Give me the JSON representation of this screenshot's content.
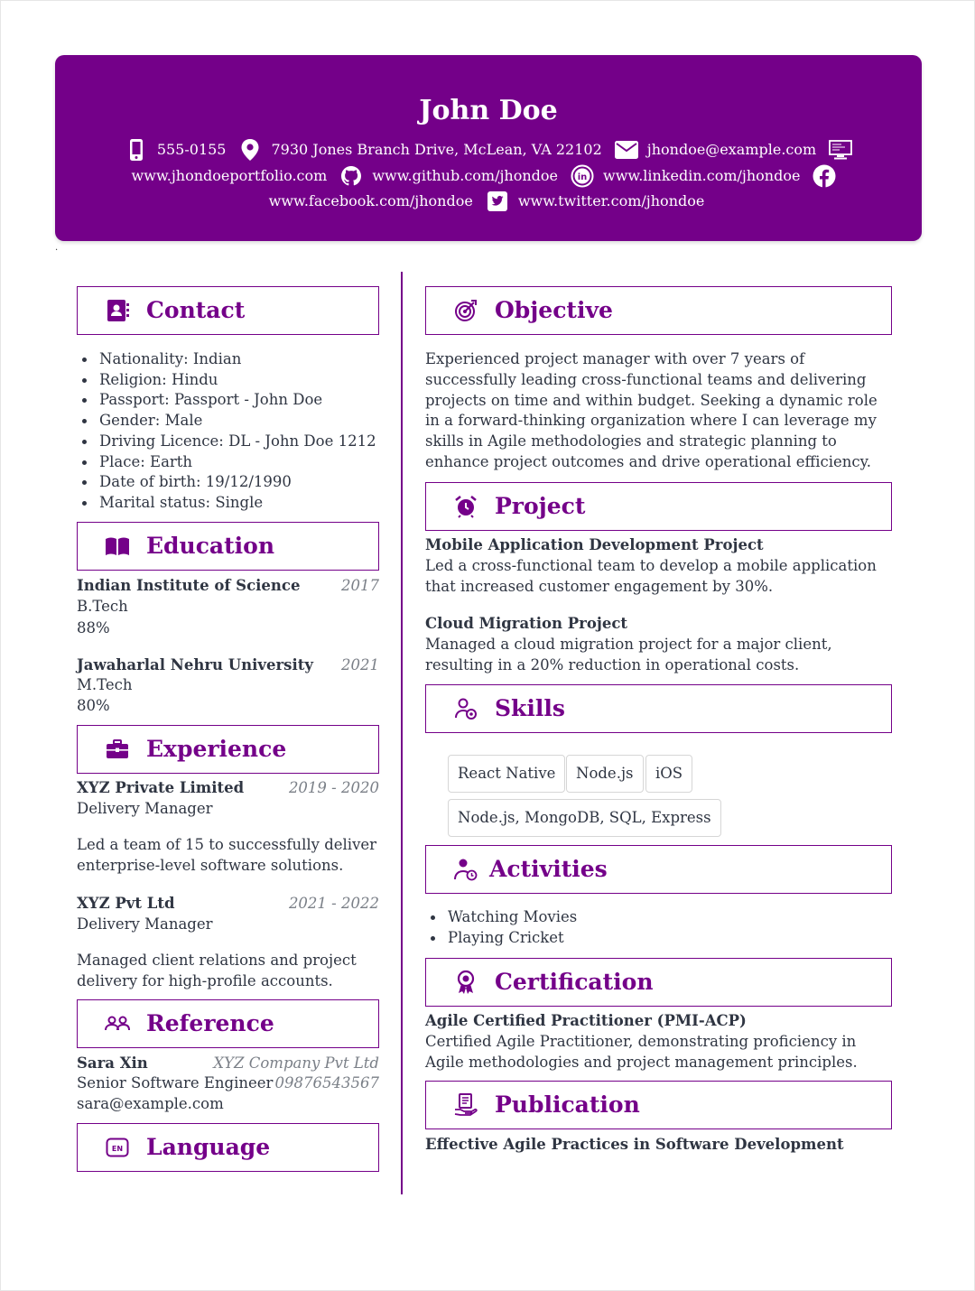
{
  "header": {
    "name": "John Doe",
    "phone": "555-0155",
    "address": "7930 Jones Branch Drive, McLean, VA 22102",
    "email": "jhondoe@example.com",
    "portfolio": "www.jhondoeportfolio.com",
    "github": "www.github.com/jhondoe",
    "linkedin": "www.linkedin.com/jhondoe",
    "facebook": "www.facebook.com/jhondoe",
    "twitter": "www.twitter.com/jhondoe",
    "marker": "."
  },
  "colors": {
    "accent": "#740089",
    "text": "#2f3542",
    "muted": "#7a7f87"
  },
  "contact": {
    "title": "Contact",
    "items": [
      "Nationality: Indian",
      "Religion: Hindu",
      "Passport: Passport - John Doe",
      "Gender: Male",
      "Driving Licence: DL - John Doe 1212",
      "Place: Earth",
      "Date of birth: 19/12/1990",
      "Marital status: Single"
    ]
  },
  "education": {
    "title": "Education",
    "items": [
      {
        "school": "Indian Institute of Science",
        "year": "2017",
        "degree": "B.Tech",
        "score": "88%"
      },
      {
        "school": "Jawaharlal Nehru University",
        "year": "2021",
        "degree": "M.Tech",
        "score": "80%"
      }
    ]
  },
  "experience": {
    "title": "Experience",
    "items": [
      {
        "company": "XYZ Private Limited",
        "period": "2019 - 2020",
        "role": "Delivery Manager",
        "desc": "Led a team of 15 to successfully deliver enterprise-level software solutions."
      },
      {
        "company": "XYZ Pvt Ltd",
        "period": "2021 - 2022",
        "role": "Delivery Manager",
        "desc": "Managed client relations and project delivery for high-profile accounts."
      }
    ]
  },
  "reference": {
    "title": "Reference",
    "name": "Sara Xin",
    "company": "XYZ Company Pvt Ltd",
    "role": "Senior Software Engineer",
    "phone": "09876543567",
    "email": "sara@example.com"
  },
  "language": {
    "title": "Language",
    "icon_text": "EN"
  },
  "objective": {
    "title": "Objective",
    "text": "Experienced project manager with over 7 years of successfully leading cross-functional teams and delivering projects on time and within budget. Seeking a dynamic role in a forward-thinking organization where I can leverage my skills in Agile methodologies and strategic planning to enhance project outcomes and drive operational efficiency."
  },
  "project": {
    "title": "Project",
    "items": [
      {
        "name": "Mobile Application Development Project",
        "desc": "Led a cross-functional team to develop a mobile application that increased customer engagement by 30%."
      },
      {
        "name": "Cloud Migration Project",
        "desc": "Managed a cloud migration project for a major client, resulting in a 20% reduction in operational costs."
      }
    ]
  },
  "skills": {
    "title": "Skills",
    "chips": [
      "React Native",
      "Node.js",
      "iOS",
      "Node.js, MongoDB, SQL, Express"
    ]
  },
  "activities": {
    "title": "Activities",
    "items": [
      "Watching Movies",
      "Playing Cricket"
    ]
  },
  "certification": {
    "title": "Certification",
    "name": "Agile Certified Practitioner (PMI-ACP)",
    "desc": "Certified Agile Practitioner, demonstrating proficiency in Agile methodologies and project management principles."
  },
  "publication": {
    "title": "Publication",
    "name": "Effective Agile Practices in Software Development"
  },
  "icons": {
    "phone": "mobile-phone-icon",
    "location": "map-marker-icon",
    "email": "envelope-icon",
    "portfolio": "desktop-icon",
    "github": "github-icon",
    "linkedin": "linkedin-icon",
    "facebook": "facebook-icon",
    "twitter": "twitter-icon"
  }
}
